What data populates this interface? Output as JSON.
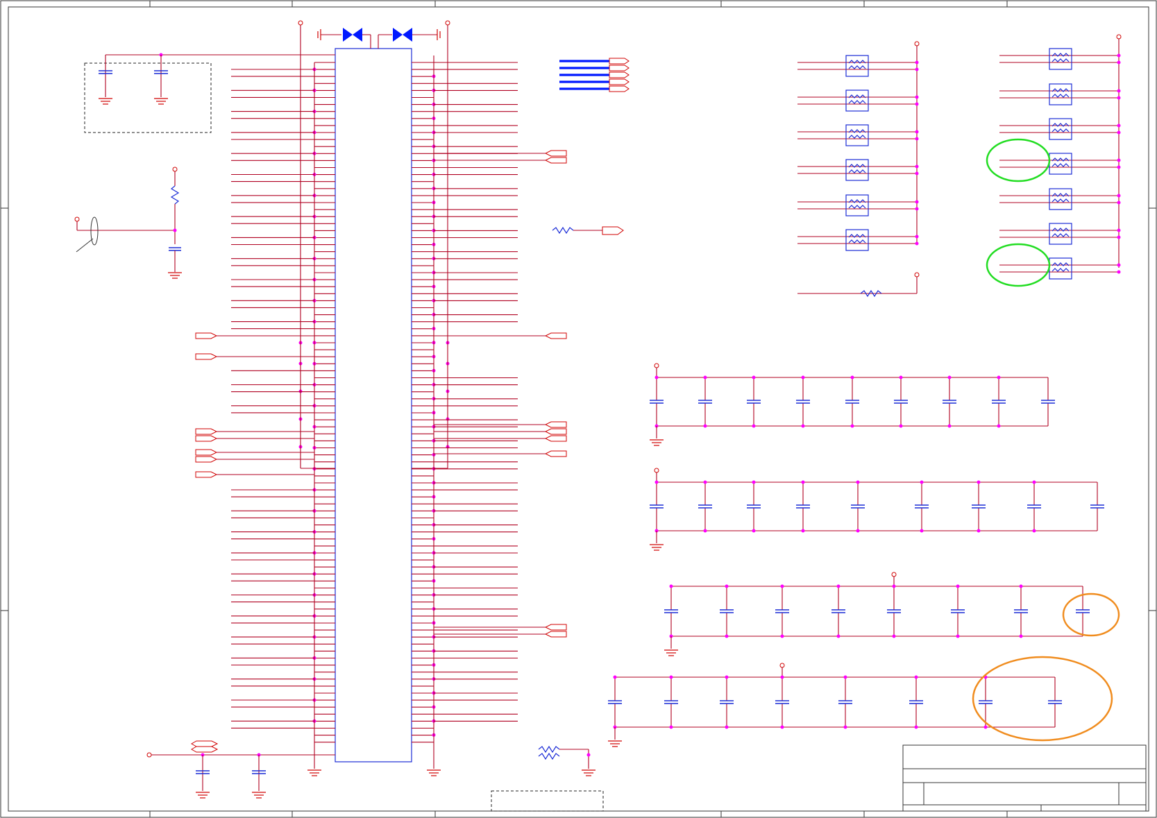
{
  "schematic": {
    "highlight_colors": {
      "green": "#22dd22",
      "orange": "#f08c1e"
    },
    "wire_color": "#b00020",
    "body_color": "#1a2bd6",
    "junction_color": "#ff00ff"
  },
  "icons": [
    "ground-symbol",
    "power-symbol",
    "capacitor-symbol",
    "resistor-symbol",
    "ferrite-bead-symbol",
    "off-sheet-connector",
    "junction-dot",
    "jumper-symbol"
  ]
}
